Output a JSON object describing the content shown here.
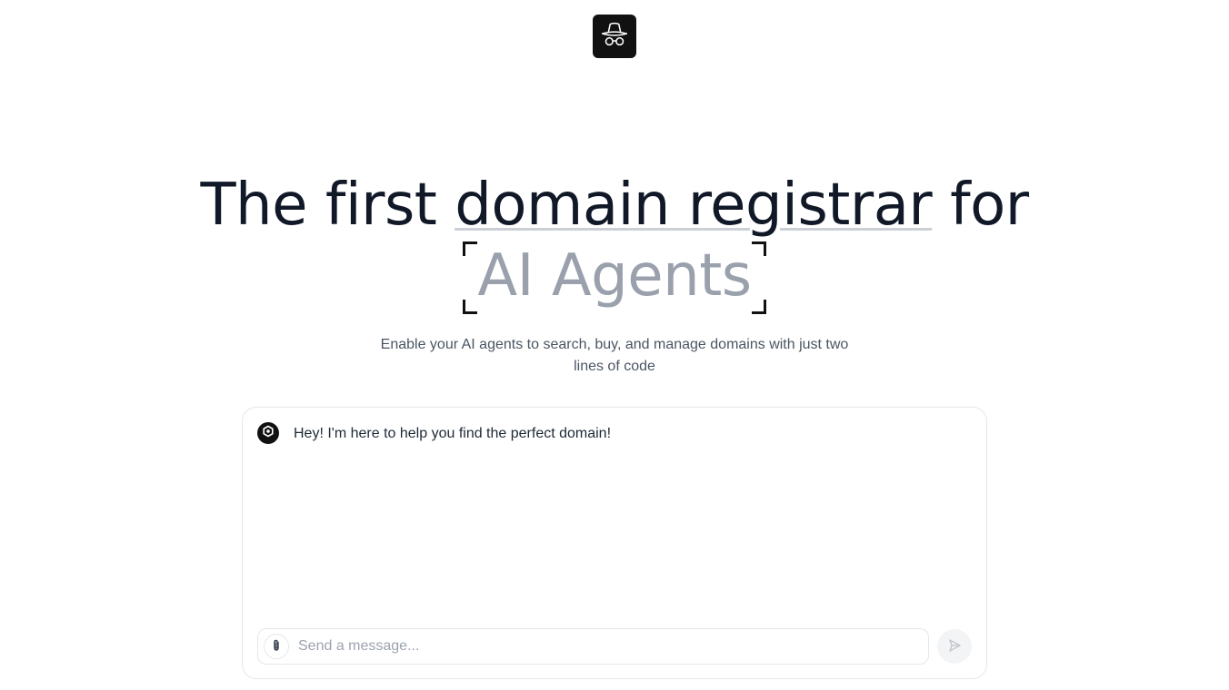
{
  "header": {
    "logo_icon": "incognito-hat-glasses-icon"
  },
  "hero": {
    "headline_prefix": "The first ",
    "headline_underlined": "domain registrar",
    "headline_suffix": " for",
    "headline_highlight": "AI Agents",
    "subtitle": "Enable your AI agents to search, buy, and manage domains with just two lines of code"
  },
  "chat": {
    "bot_avatar_icon": "bot-hexagon-icon",
    "bot_message": "Hey! I'm here to help you find the perfect domain!",
    "input_placeholder": "Send a message...",
    "input_value": "",
    "attach_icon": "paperclip-icon",
    "send_icon": "send-arrow-icon"
  },
  "colors": {
    "text_primary": "#111827",
    "text_muted": "#9aa1ad",
    "underline": "#cbd0d6",
    "logo_bg": "#111111",
    "border": "#e5e7eb",
    "send_bg": "#f3f4f6"
  }
}
